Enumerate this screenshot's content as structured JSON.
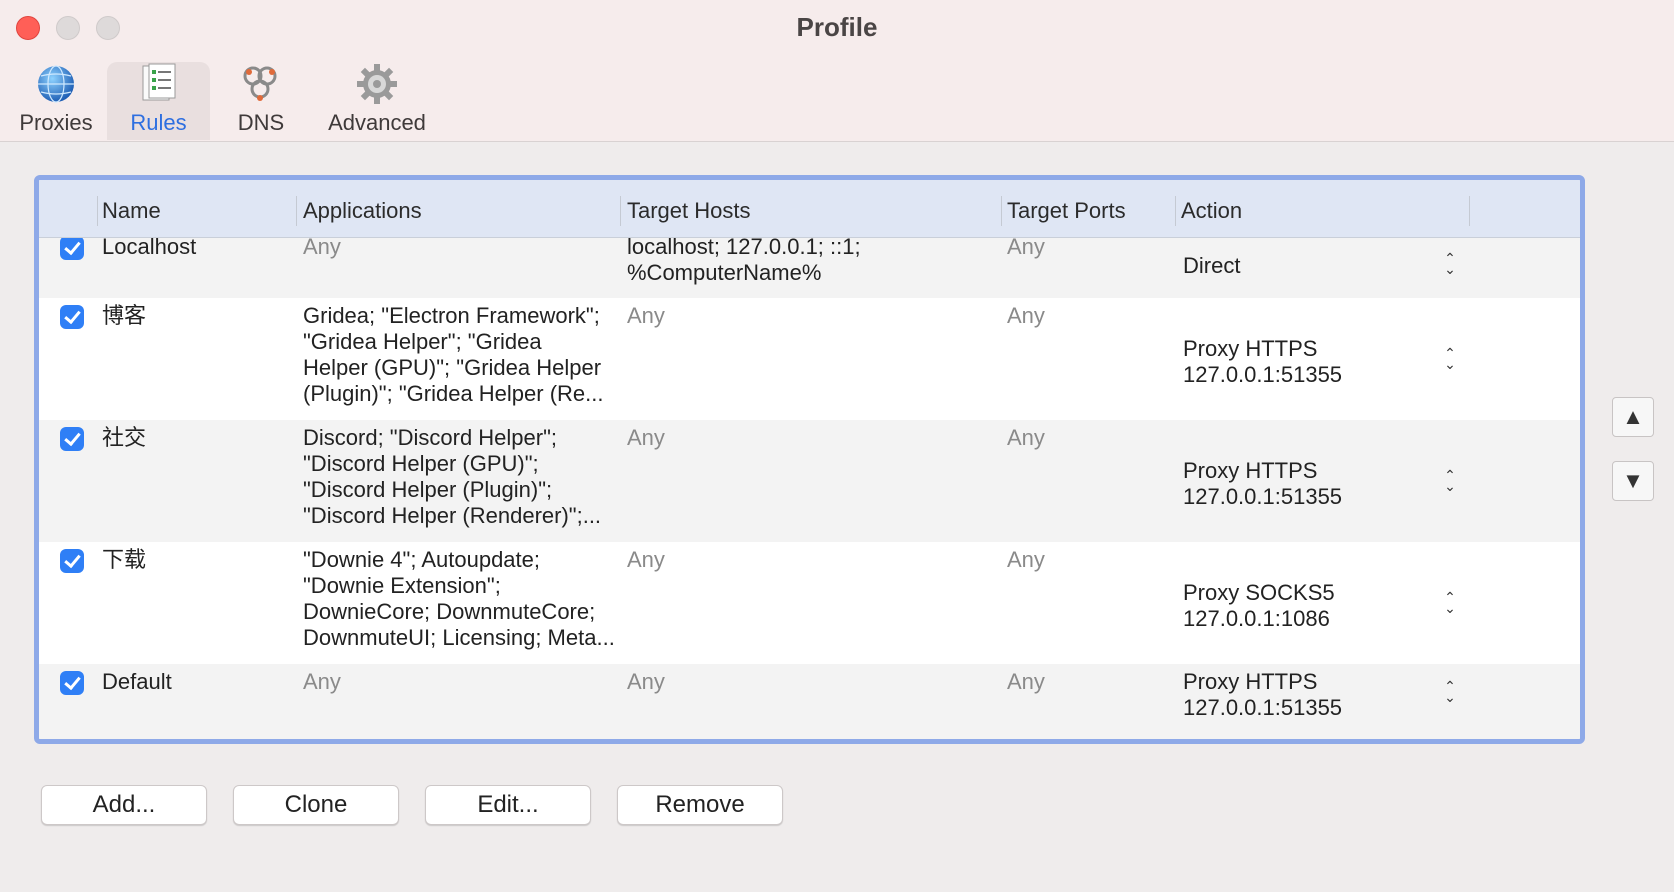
{
  "window": {
    "title": "Profile"
  },
  "tabs": [
    {
      "label": "Proxies",
      "icon": "globe-icon",
      "active": false
    },
    {
      "label": "Rules",
      "icon": "rules-list-icon",
      "active": true
    },
    {
      "label": "DNS",
      "icon": "dns-icon",
      "active": false
    },
    {
      "label": "Advanced",
      "icon": "gear-icon",
      "active": false
    }
  ],
  "table": {
    "columns": {
      "name": "Name",
      "applications": "Applications",
      "hosts": "Target Hosts",
      "ports": "Target Ports",
      "action": "Action"
    },
    "rows": [
      {
        "checked": true,
        "name": "Localhost",
        "applications": [
          "Any"
        ],
        "hosts": [
          "localhost; 127.0.0.1; ::1;",
          "%ComputerName%"
        ],
        "ports": "Any",
        "action": [
          "Direct"
        ]
      },
      {
        "checked": true,
        "name": "博客",
        "applications": [
          "Gridea; \"Electron Framework\";",
          "\"Gridea Helper\"; \"Gridea",
          "Helper (GPU)\"; \"Gridea Helper",
          "(Plugin)\"; \"Gridea Helper (Re..."
        ],
        "hosts": [
          "Any"
        ],
        "ports": "Any",
        "action": [
          "Proxy HTTPS",
          "127.0.0.1:51355"
        ]
      },
      {
        "checked": true,
        "name": "社交",
        "applications": [
          "Discord; \"Discord Helper\";",
          "\"Discord Helper (GPU)\";",
          "\"Discord Helper (Plugin)\";",
          "\"Discord Helper (Renderer)\";..."
        ],
        "hosts": [
          "Any"
        ],
        "ports": "Any",
        "action": [
          "Proxy HTTPS",
          "127.0.0.1:51355"
        ]
      },
      {
        "checked": true,
        "name": "下载",
        "applications": [
          "\"Downie 4\"; Autoupdate;",
          "\"Downie Extension\";",
          "DownieCore; DownmuteCore;",
          "DownmuteUI; Licensing; Meta..."
        ],
        "hosts": [
          "Any"
        ],
        "ports": "Any",
        "action": [
          "Proxy SOCKS5",
          "127.0.0.1:1086"
        ]
      },
      {
        "checked": true,
        "name": "Default",
        "applications": [
          "Any"
        ],
        "hosts": [
          "Any"
        ],
        "ports": "Any",
        "action": [
          "Proxy HTTPS",
          "127.0.0.1:51355"
        ]
      }
    ]
  },
  "move_buttons": {
    "up": "▲",
    "down": "▼"
  },
  "buttons": {
    "add": "Add...",
    "clone": "Clone",
    "edit": "Edit...",
    "remove": "Remove"
  },
  "colors": {
    "accent": "#2f7ff6",
    "selection_border": "#8ea9e8",
    "active_tab_text": "#2e6fe0",
    "close": "#ff5f57"
  }
}
